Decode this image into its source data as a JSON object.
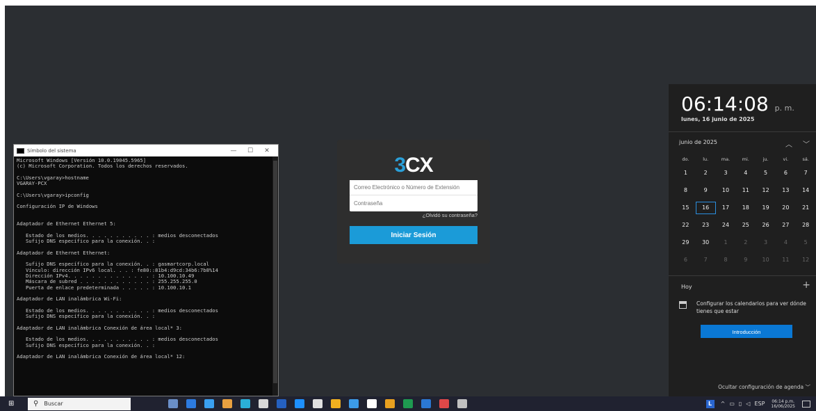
{
  "cmd": {
    "title": "Símbolo del sistema",
    "controls": [
      "—",
      "☐",
      "✕"
    ],
    "lines": [
      "Microsoft Windows [Versión 10.0.19045.5965]",
      "(c) Microsoft Corporation. Todos los derechos reservados.",
      "",
      "C:\\Users\\vgaray>hostname",
      "VGARAY-PCX",
      "",
      "C:\\Users\\vgaray>ipconfig",
      "",
      "Configuración IP de Windows",
      "",
      "",
      "Adaptador de Ethernet Ethernet 5:",
      "",
      "   Estado de los medios. . . . . . . . . . . : medios desconectados",
      "   Sufijo DNS específico para la conexión. . :",
      "",
      "Adaptador de Ethernet Ethernet:",
      "",
      "   Sufijo DNS específico para la conexión. . : gasmartcorp.local",
      "   Vínculo: dirección IPv6 local. . . : fe80::81b4:d9cd:34b6:7b8%14",
      "   Dirección IPv4. . . . . . . . . . . . . . : 10.100.10.49",
      "   Máscara de subred . . . . . . . . . . . . : 255.255.255.0",
      "   Puerta de enlace predeterminada . . . . . : 10.100.10.1",
      "",
      "Adaptador de LAN inalámbrica Wi-Fi:",
      "",
      "   Estado de los medios. . . . . . . . . . . : medios desconectados",
      "   Sufijo DNS específico para la conexión. . :",
      "",
      "Adaptador de LAN inalámbrica Conexión de área local* 3:",
      "",
      "   Estado de los medios. . . . . . . . . . . : medios desconectados",
      "   Sufijo DNS específico para la conexión. . :",
      "",
      "Adaptador de LAN inalámbrica Conexión de área local* 12:"
    ]
  },
  "login": {
    "logo_prefix": "3",
    "logo_suffix": "CX",
    "email_placeholder": "Correo Electrónico o Número de Extensión",
    "password_placeholder": "Contraseña",
    "forgot_link": "¿Olvidó su contraseña?",
    "signin_button": "Iniciar Sesión"
  },
  "calendar": {
    "time": "06:14:08",
    "ampm": "p. m.",
    "date": "lunes, 16 junio de 2025",
    "month": "junio de 2025",
    "weekdays": [
      "do.",
      "lu.",
      "ma.",
      "mi.",
      "ju.",
      "vi.",
      "sá."
    ],
    "weeks": [
      [
        "1",
        "2",
        "3",
        "4",
        "5",
        "6",
        "7"
      ],
      [
        "8",
        "9",
        "10",
        "11",
        "12",
        "13",
        "14"
      ],
      [
        "15",
        "16",
        "17",
        "18",
        "19",
        "20",
        "21"
      ],
      [
        "22",
        "23",
        "24",
        "25",
        "26",
        "27",
        "28"
      ],
      [
        "29",
        "30",
        "1",
        "2",
        "3",
        "4",
        "5"
      ],
      [
        "6",
        "7",
        "8",
        "9",
        "10",
        "11",
        "12"
      ]
    ],
    "today_label": "Hoy",
    "configure_text": "Configurar los calendarios para ver dónde tienes que estar",
    "intro_button": "Introducción",
    "hide_agenda": "Ocultar configuración de agenda"
  },
  "taskbar": {
    "search_placeholder": "Buscar",
    "app_icon_colors": [
      "#6a8fc8",
      "#2d7be0",
      "#3aa0f0",
      "#e8a040",
      "#2bb0d8",
      "#d8d8d8",
      "#2560c0",
      "#1e90ff",
      "#e0e0e0",
      "#f0b020",
      "#3c9be8",
      "#ffffff",
      "#e8a020",
      "#1e9a50",
      "#2b78d4",
      "#e04848",
      "#c0c0c0"
    ],
    "tray_language": "ESP",
    "tray_time": "06:14 p.m.",
    "tray_date": "16/06/2025",
    "tray_badge": "L"
  }
}
